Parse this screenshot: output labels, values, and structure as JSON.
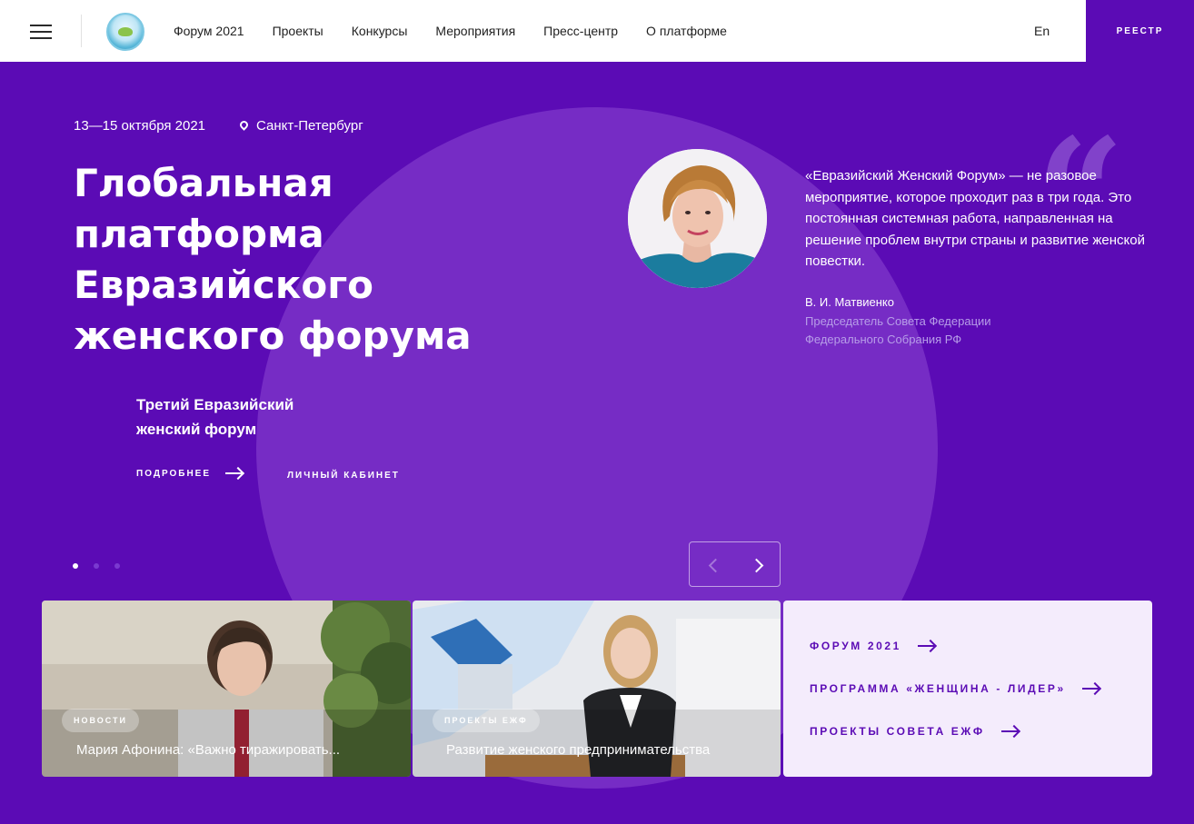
{
  "header": {
    "nav": [
      "Форум 2021",
      "Проекты",
      "Конкурсы",
      "Мероприятия",
      "Пресс-центр",
      "О платформе"
    ],
    "lang": "En",
    "registry": "РЕЕСТР"
  },
  "hero": {
    "dates": "13—15 октября 2021",
    "city": "Санкт-Петербург",
    "title": "Глобальная платформа Евразийского женского форума",
    "subtitle": "Третий Евразийский женский форум",
    "more": "ПОДРОБНЕЕ",
    "cabinet": "ЛИЧНЫЙ КАБИНЕТ",
    "slide_index": 1,
    "slide_total": 3
  },
  "quote": {
    "text": "«Евразийский Женский Форум» — не разовое мероприятие, которое проходит раз в три года. Это постоянная системная работа, направленная на решение проблем внутри страны и развитие женской повестки.",
    "author": "В. И. Матвиенко",
    "role": "Председатель Совета Федерации Федерального Собрания РФ"
  },
  "cards": [
    {
      "badge": "НОВОСТИ",
      "title": "Мария Афонина: «Важно тиражировать..."
    },
    {
      "badge": "ПРОЕКТЫ ЕЖФ",
      "title": "Развитие женского предпринимательства"
    }
  ],
  "quick_links": [
    "ФОРУМ 2021",
    "ПРОГРАММА «ЖЕНЩИНА - ЛИДЕР»",
    "ПРОЕКТЫ СОВЕТА ЕЖФ"
  ],
  "colors": {
    "brand": "#5b0bb5",
    "panel": "#f4ecfc"
  }
}
